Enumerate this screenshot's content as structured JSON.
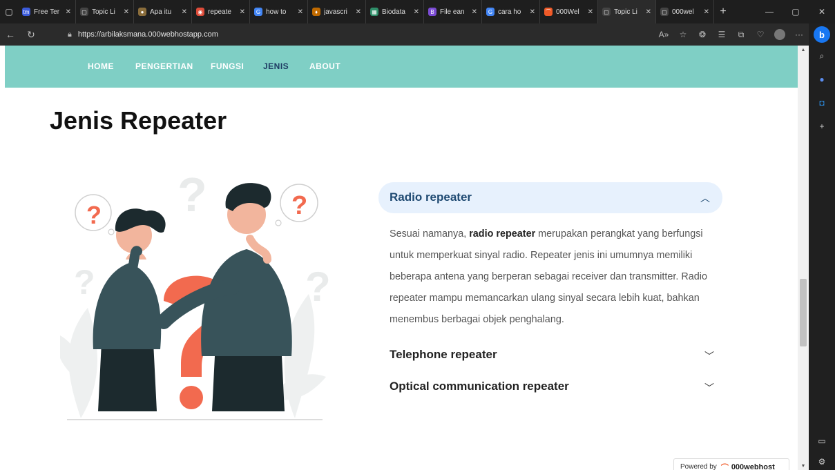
{
  "browser": {
    "tabs": [
      {
        "title": "Free Ter",
        "fav_color": "#3b5bdb",
        "fav_glyph": "tm"
      },
      {
        "title": "Topic Li",
        "fav_color": "#444444",
        "fav_glyph": "▢"
      },
      {
        "title": "Apa itu",
        "fav_color": "#8a6d3b",
        "fav_glyph": "●"
      },
      {
        "title": "repeate",
        "fav_color": "#dd4b39",
        "fav_glyph": "◉"
      },
      {
        "title": "how to",
        "fav_color": "#4285f4",
        "fav_glyph": "G"
      },
      {
        "title": "javascri",
        "fav_color": "#c06a00",
        "fav_glyph": "♦"
      },
      {
        "title": "Biodata",
        "fav_color": "#2f8f6a",
        "fav_glyph": "▦"
      },
      {
        "title": "File ean",
        "fav_color": "#7b4bd4",
        "fav_glyph": "B"
      },
      {
        "title": "cara ho",
        "fav_color": "#4285f4",
        "fav_glyph": "G"
      },
      {
        "title": "000Wel",
        "fav_color": "#f05a28",
        "fav_glyph": "⌒"
      },
      {
        "title": "Topic Li",
        "fav_color": "#444444",
        "fav_glyph": "▢"
      },
      {
        "title": "000wel",
        "fav_color": "#444444",
        "fav_glyph": "▢"
      }
    ],
    "url": "https://arbilaksmana.000webhostapp.com"
  },
  "nav": {
    "items": [
      "HOME",
      "PENGERTIAN",
      "FUNGSI",
      "JENIS",
      "ABOUT"
    ]
  },
  "page": {
    "title": "Jenis Repeater"
  },
  "accordion": {
    "open_item": "Radio repeater",
    "body_pre": "Sesuai namanya, ",
    "body_bold": "radio repeater",
    "body_post": " merupakan perangkat yang berfungsi untuk memperkuat sinyal radio. Repeater jenis ini umumnya memiliki beberapa antena yang berperan sebagai receiver dan transmitter. Radio repeater mampu memancarkan ulang sinyal secara lebih kuat, bahkan menembus berbagai objek penghalang.",
    "closed_items": [
      "Telephone repeater",
      "Optical communication repeater"
    ]
  },
  "footer": {
    "powered_by": "Powered by",
    "brand": "000webhost"
  },
  "colors": {
    "nav_bg": "#7fcfc5",
    "nav_active": "#1f3d64",
    "accordion_open_bg": "#e7f1fd",
    "accent_orange": "#f26a4f"
  }
}
